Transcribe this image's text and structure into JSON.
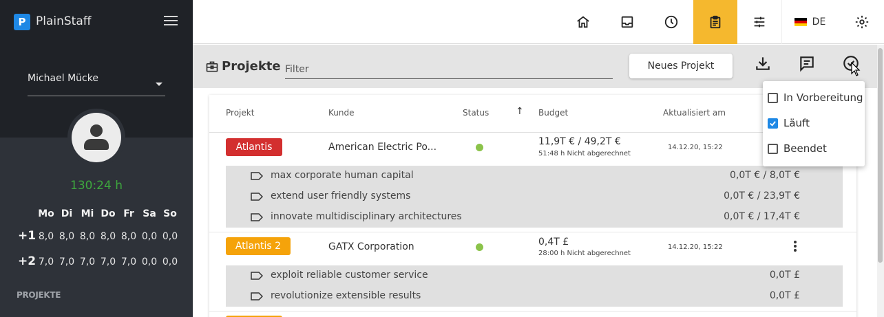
{
  "app": {
    "name": "PlainStaff"
  },
  "user": {
    "name": "Michael Mücke",
    "hours": "130:24 h"
  },
  "week": {
    "days": [
      "Mo",
      "Di",
      "Mi",
      "Do",
      "Fr",
      "Sa",
      "So"
    ],
    "rows": [
      {
        "label": "+1",
        "values": [
          "8,0",
          "8,0",
          "8,0",
          "8,0",
          "8,0",
          "0,0",
          "0,0"
        ]
      },
      {
        "label": "+2",
        "values": [
          "7,0",
          "7,0",
          "7,0",
          "7,0",
          "7,0",
          "0,0",
          "0,0"
        ]
      }
    ]
  },
  "sidebar": {
    "section_label": "PROJEKTE"
  },
  "topbar": {
    "icons": [
      "home-icon",
      "inbox-icon",
      "clock-icon",
      "clipboard-icon",
      "sliders-icon"
    ],
    "active_icon": "clipboard-icon",
    "language": "DE",
    "flag_colors": [
      "#000000",
      "#dd0000",
      "#ffce00"
    ]
  },
  "header": {
    "title": "Projekte",
    "filter_placeholder": "Filter",
    "new_project_label": "Neues Projekt"
  },
  "table": {
    "columns": [
      "Projekt",
      "Kunde",
      "Status",
      "Budget",
      "Aktualisiert am"
    ],
    "sort_arrow": "↑",
    "rows": [
      {
        "project": "Atlantis",
        "badge_color": "#d32f2f",
        "customer": "American Electric Po...",
        "budget": "11,9T €   / 49,2T €",
        "budget_note": "51:48 h Nicht abgerechnet",
        "updated": "14.12.20, 15:22",
        "sub_items": [
          {
            "label": "max corporate human capital",
            "value": "0,0T € / 8,0T €"
          },
          {
            "label": "extend user friendly systems",
            "value": "0,0T € / 23,9T €"
          },
          {
            "label": "innovate multidisciplinary architectures",
            "value": "0,0T € / 17,4T €"
          }
        ]
      },
      {
        "project": "Atlantis 2",
        "badge_color": "#f5a30a",
        "customer": "GATX Corporation",
        "budget": "0,4T £",
        "budget_note": "28:00 h Nicht abgerechnet",
        "updated": "14.12.20, 15:22",
        "sub_items": [
          {
            "label": "exploit reliable customer service",
            "value": "0,0T £"
          },
          {
            "label": "revolutionize extensible results",
            "value": "0,0T £"
          }
        ]
      }
    ]
  },
  "status_filter": {
    "options": [
      {
        "label": "In Vorbereitung",
        "checked": false
      },
      {
        "label": "Läuft",
        "checked": true
      },
      {
        "label": "Beendet",
        "checked": false
      }
    ]
  },
  "colors": {
    "accent": "#f5b82e",
    "status_running": "#8bc34a",
    "hours_green": "#3ea83e"
  }
}
